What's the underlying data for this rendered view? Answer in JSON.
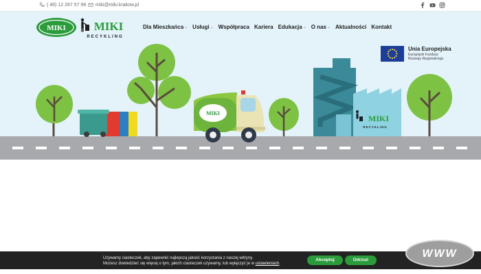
{
  "topbar": {
    "phone": "( 48) 12 267 57 98",
    "email": "miki@miki.krakow.pl",
    "social": [
      "facebook-icon",
      "youtube-icon",
      "instagram-icon"
    ]
  },
  "logo": {
    "left_word": "MIKI",
    "right_word": "MIKI",
    "tagline": "RECYKLING"
  },
  "nav": {
    "items": [
      {
        "label": "Dla Mieszkańca",
        "dropdown": true
      },
      {
        "label": "Usługi",
        "dropdown": true
      },
      {
        "label": "Współpraca",
        "dropdown": false
      },
      {
        "label": "Kariera",
        "dropdown": false
      },
      {
        "label": "Edukacja",
        "dropdown": true
      },
      {
        "label": "O nas",
        "dropdown": true
      },
      {
        "label": "Aktualności",
        "dropdown": false
      },
      {
        "label": "Kontakt",
        "dropdown": false
      }
    ]
  },
  "eu": {
    "title": "Unia Europejska",
    "line1": "Europejski Fundusz",
    "line2": "Rozwoju Regionalnego"
  },
  "scene": {
    "truck_label": "MIKI",
    "factory_label": "MIKI",
    "factory_tagline": "RECYKLING"
  },
  "cookie": {
    "line1": "Używamy ciasteczek, aby zapewnić najlepszą jakość korzystania z naszej witryny.",
    "line2_prefix": "Możesz dowiedzieć się więcej o tym, jakich ciasteczek używamy, lub wyłączyć je w ",
    "line2_link": "ustawieniach",
    "line2_suffix": ".",
    "accept": "Akceptuj",
    "reject": "Odrzuć"
  },
  "watermark": "WWW",
  "colors": {
    "brand_green": "#2a9d3a",
    "tree_green": "#7dc242",
    "road_gray": "#a7a9ac",
    "sky": "#e3f3f9",
    "factory_teal": "#3a8a99"
  }
}
